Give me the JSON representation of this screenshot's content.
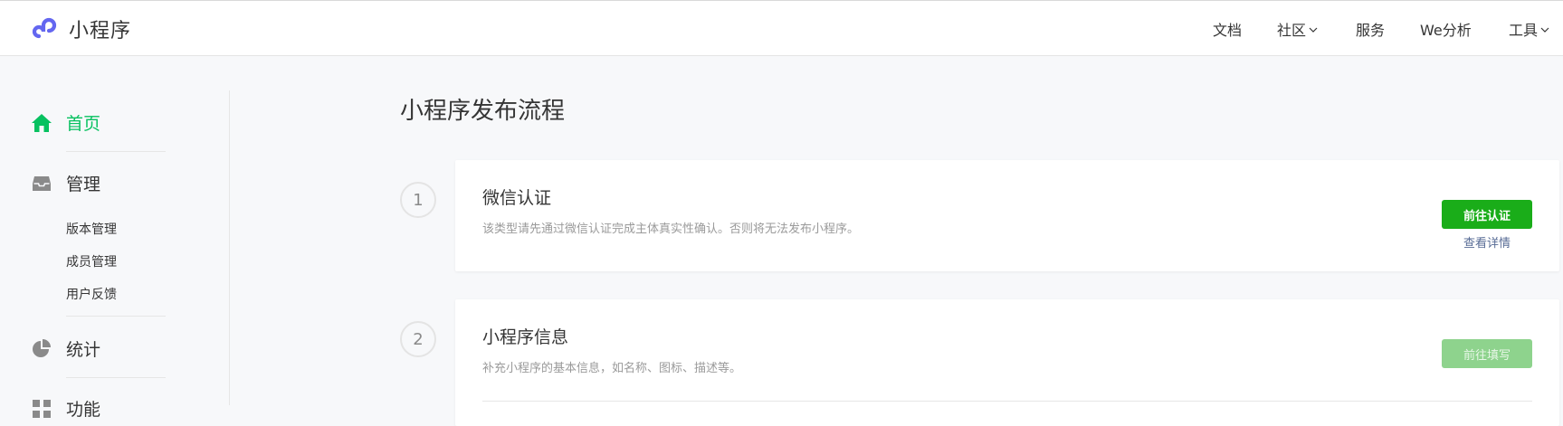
{
  "header": {
    "brand_name": "小程序",
    "logo_icon": "miniprogram-logo-icon",
    "nav": [
      {
        "label": "文档",
        "has_dropdown": false
      },
      {
        "label": "社区",
        "has_dropdown": true
      },
      {
        "label": "服务",
        "has_dropdown": false
      },
      {
        "label": "We分析",
        "has_dropdown": false
      },
      {
        "label": "工具",
        "has_dropdown": true
      }
    ]
  },
  "sidebar": {
    "items": [
      {
        "label": "首页",
        "icon": "home-icon",
        "active": true
      },
      {
        "label": "管理",
        "icon": "inbox-icon",
        "active": false,
        "children": [
          "版本管理",
          "成员管理",
          "用户反馈"
        ]
      },
      {
        "label": "统计",
        "icon": "pie-chart-icon",
        "active": false
      },
      {
        "label": "功能",
        "icon": "grid-icon",
        "active": false
      }
    ]
  },
  "main": {
    "title": "小程序发布流程",
    "steps": [
      {
        "number": "1",
        "title": "微信认证",
        "description": "该类型请先通过微信认证完成主体真实性确认。否则将无法发布小程序。",
        "button_label": "前往认证",
        "button_enabled": true,
        "link_label": "查看详情"
      },
      {
        "number": "2",
        "title": "小程序信息",
        "description": "补充小程序的基本信息，如名称、图标、描述等。",
        "button_label": "前往填写",
        "button_enabled": false
      }
    ]
  },
  "colors": {
    "accent_green": "#07c160",
    "button_green": "#1aad19",
    "button_disabled": "#8ed38d",
    "link_blue": "#576b95",
    "logo_purple": "#6467f0"
  }
}
